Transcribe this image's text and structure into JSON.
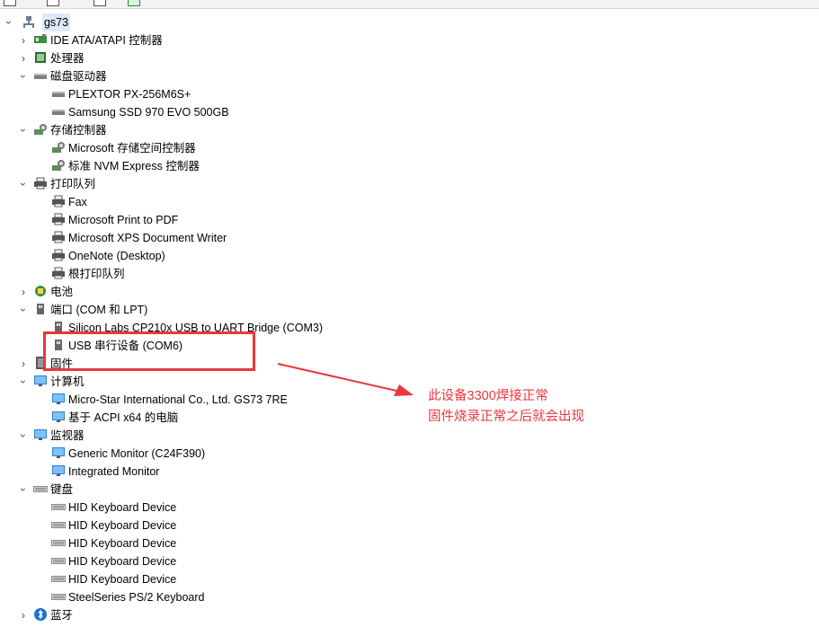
{
  "tree": {
    "root": {
      "label": "gs73",
      "icon": "computer-network-icon"
    },
    "items": [
      {
        "level": 1,
        "chevron": "collapsed",
        "icon": "ide-controller-icon",
        "label": "IDE ATA/ATAPI 控制器"
      },
      {
        "level": 1,
        "chevron": "collapsed",
        "icon": "processor-icon",
        "label": "处理器"
      },
      {
        "level": 1,
        "chevron": "expanded",
        "icon": "disk-drive-icon",
        "label": "磁盘驱动器"
      },
      {
        "level": 2,
        "icon": "disk-drive-icon",
        "label": "PLEXTOR PX-256M6S+"
      },
      {
        "level": 2,
        "icon": "disk-drive-icon",
        "label": "Samsung SSD 970 EVO 500GB"
      },
      {
        "level": 1,
        "chevron": "expanded",
        "icon": "storage-controller-icon",
        "label": "存储控制器"
      },
      {
        "level": 2,
        "icon": "storage-controller-icon",
        "label": "Microsoft 存储空间控制器"
      },
      {
        "level": 2,
        "icon": "storage-controller-icon",
        "label": "标准 NVM Express 控制器"
      },
      {
        "level": 1,
        "chevron": "expanded",
        "icon": "printer-icon",
        "label": "打印队列"
      },
      {
        "level": 2,
        "icon": "printer-icon",
        "label": "Fax"
      },
      {
        "level": 2,
        "icon": "printer-icon",
        "label": "Microsoft Print to PDF"
      },
      {
        "level": 2,
        "icon": "printer-icon",
        "label": "Microsoft XPS Document Writer"
      },
      {
        "level": 2,
        "icon": "printer-icon",
        "label": "OneNote (Desktop)"
      },
      {
        "level": 2,
        "icon": "printer-icon",
        "label": "根打印队列"
      },
      {
        "level": 1,
        "chevron": "collapsed",
        "icon": "battery-icon",
        "label": "电池"
      },
      {
        "level": 1,
        "chevron": "expanded",
        "icon": "port-icon",
        "label": "端口 (COM 和 LPT)"
      },
      {
        "level": 2,
        "icon": "port-icon",
        "label": "Silicon Labs CP210x USB to UART Bridge (COM3)"
      },
      {
        "level": 2,
        "icon": "port-icon",
        "label": "USB 串行设备 (COM6)"
      },
      {
        "level": 1,
        "chevron": "collapsed",
        "icon": "firmware-icon",
        "label": "固件"
      },
      {
        "level": 1,
        "chevron": "expanded",
        "icon": "monitor-icon",
        "label": "计算机"
      },
      {
        "level": 2,
        "icon": "monitor-icon",
        "label": "Micro-Star International Co., Ltd. GS73 7RE"
      },
      {
        "level": 2,
        "icon": "monitor-icon",
        "label": "基于 ACPI x64 的电脑"
      },
      {
        "level": 1,
        "chevron": "expanded",
        "icon": "monitor-icon",
        "label": "监视器"
      },
      {
        "level": 2,
        "icon": "monitor-icon",
        "label": "Generic Monitor (C24F390)"
      },
      {
        "level": 2,
        "icon": "monitor-icon",
        "label": "Integrated Monitor"
      },
      {
        "level": 1,
        "chevron": "expanded",
        "icon": "keyboard-icon",
        "label": "键盘"
      },
      {
        "level": 2,
        "icon": "keyboard-icon",
        "label": "HID Keyboard Device"
      },
      {
        "level": 2,
        "icon": "keyboard-icon",
        "label": "HID Keyboard Device"
      },
      {
        "level": 2,
        "icon": "keyboard-icon",
        "label": "HID Keyboard Device"
      },
      {
        "level": 2,
        "icon": "keyboard-icon",
        "label": "HID Keyboard Device"
      },
      {
        "level": 2,
        "icon": "keyboard-icon",
        "label": "HID Keyboard Device"
      },
      {
        "level": 2,
        "icon": "keyboard-icon",
        "label": "SteelSeries PS/2 Keyboard"
      },
      {
        "level": 1,
        "chevron": "collapsed",
        "icon": "bluetooth-icon",
        "label": "蓝牙"
      }
    ]
  },
  "annotation": {
    "line1": "此设备3300焊接正常",
    "line2": "固件烧录正常之后就会出现",
    "color": "#e8383d"
  }
}
